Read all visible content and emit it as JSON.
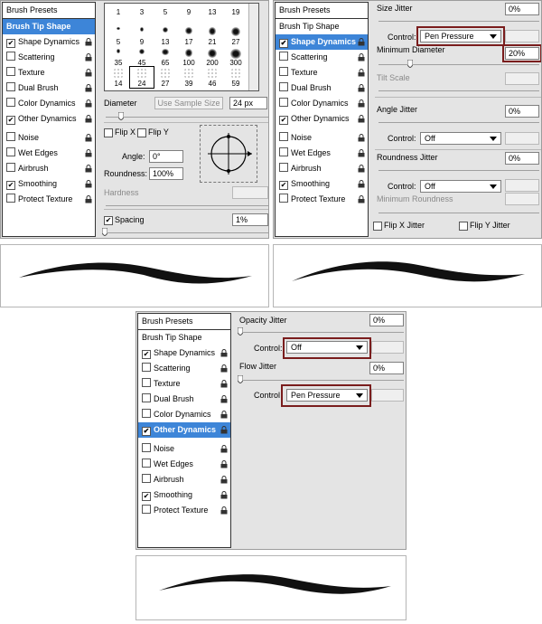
{
  "sidebar": {
    "header": "Brush Presets",
    "items": [
      {
        "label": "Brush Tip Shape",
        "checkbox": false
      },
      {
        "label": "Shape Dynamics",
        "checkbox": true,
        "checked": true
      },
      {
        "label": "Scattering",
        "checkbox": true,
        "checked": false
      },
      {
        "label": "Texture",
        "checkbox": true,
        "checked": false
      },
      {
        "label": "Dual Brush",
        "checkbox": true,
        "checked": false
      },
      {
        "label": "Color Dynamics",
        "checkbox": true,
        "checked": false
      },
      {
        "label": "Other Dynamics",
        "checkbox": true,
        "checked": true
      },
      {
        "label": "Noise",
        "checkbox": true,
        "checked": false
      },
      {
        "label": "Wet Edges",
        "checkbox": true,
        "checked": false
      },
      {
        "label": "Airbrush",
        "checkbox": true,
        "checked": false
      },
      {
        "label": "Smoothing",
        "checkbox": true,
        "checked": true
      },
      {
        "label": "Protect Texture",
        "checkbox": true,
        "checked": false
      }
    ]
  },
  "tip_shape": {
    "sizes_row1": [
      "1",
      "3",
      "5",
      "9",
      "13",
      "19"
    ],
    "sizes_row2": [
      "5",
      "9",
      "13",
      "17",
      "21",
      "27"
    ],
    "sizes_row3": [
      "35",
      "45",
      "65",
      "100",
      "200",
      "300"
    ],
    "sizes_row4": [
      "14",
      "24",
      "27",
      "39",
      "46",
      "59"
    ],
    "diameter_label": "Diameter",
    "use_sample_size": "Use Sample Size",
    "diameter_value": "24 px",
    "flip_x": "Flip X",
    "flip_y": "Flip Y",
    "angle_label": "Angle:",
    "angle_value": "0°",
    "roundness_label": "Roundness:",
    "roundness_value": "100%",
    "hardness_label": "Hardness",
    "spacing_label": "Spacing",
    "spacing_value": "1%"
  },
  "shape_dynamics": {
    "size_jitter_label": "Size Jitter",
    "size_jitter_value": "0%",
    "control_label": "Control:",
    "size_control": "Pen Pressure",
    "min_diameter_label": "Minimum Diameter",
    "min_diameter_value": "20%",
    "tilt_scale_label": "Tilt Scale",
    "angle_jitter_label": "Angle Jitter",
    "angle_jitter_value": "0%",
    "angle_control": "Off",
    "roundness_jitter_label": "Roundness Jitter",
    "roundness_jitter_value": "0%",
    "roundness_control": "Off",
    "min_roundness_label": "Minimum Roundness",
    "flip_x_jitter": "Flip X Jitter",
    "flip_y_jitter": "Flip Y Jitter"
  },
  "other_dynamics": {
    "opacity_jitter_label": "Opacity Jitter",
    "opacity_jitter_value": "0%",
    "control_label": "Control:",
    "opacity_control": "Off",
    "flow_jitter_label": "Flow Jitter",
    "flow_jitter_value": "0%",
    "flow_control_label": "Control",
    "flow_control": "Pen Pressure"
  },
  "colors": {
    "selected_item": "#3d85d8",
    "highlight_border": "#7a1d1d",
    "panel_bg": "#e4e4e4"
  }
}
